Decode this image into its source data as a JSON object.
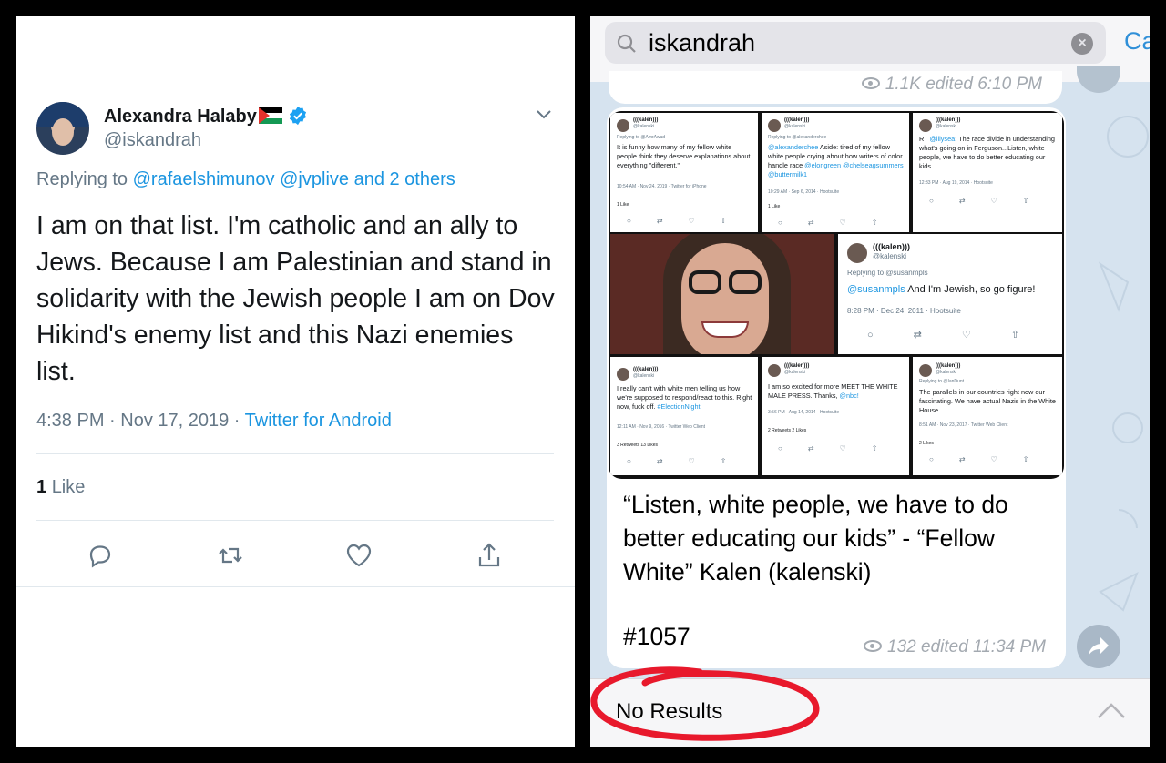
{
  "tweet": {
    "author_name": "Alexandra Halaby",
    "handle": "@iskandrah",
    "replying_prefix": "Replying to",
    "replying_user1": "@rafaelshimunov",
    "replying_user2": "@jvplive",
    "replying_suffix": "and 2 others",
    "text": "I am on that list. I'm catholic and an ally to Jews. Because I am Palestinian and stand in solidarity with the Jewish people I am on Dov Hikind's enemy list and this Nazi enemies list.",
    "time": "4:38 PM · Nov 17, 2019 ·",
    "source": "Twitter for Android",
    "like_count": "1",
    "like_label": "Like"
  },
  "telegram": {
    "search_value": "iskandrah",
    "cancel_label": "Ca",
    "prev_message_meta": "1.1K edited 6:10 PM",
    "caption": "“Listen, white people, we have to do better educating our kids” - “Fellow White” Kalen (kalenski)",
    "hashtag": "#1057",
    "views": "132",
    "edited_time": "edited 11:34 PM",
    "no_results": "No Results",
    "colors": {
      "accent": "#2f8fd8",
      "annotation": "#e8192c"
    }
  },
  "collage": {
    "cards": [
      {
        "name": "(((kalen)))",
        "handle": "@kalenski",
        "replying": "Replying to @AmrAwad",
        "text": "It is funny how many of my fellow white people think they deserve explanations about everything \"different.\"",
        "meta": "10:54 AM · Nov 24, 2019 · Twitter for iPhone",
        "stats": "1 Like"
      },
      {
        "name": "(((kalen)))",
        "handle": "@kalenski",
        "replying": "Replying to @alexanderchee",
        "text_link": "@alexanderchee",
        "text": "Aside: tired of my fellow white people crying about how writers of color handle race",
        "text_link2": "@elongreen @chelseagsummers @buttermilk1",
        "meta": "10:29 AM · Sep 6, 2014 · Hootsuite",
        "stats": "1 Like"
      },
      {
        "name": "(((kalen)))",
        "handle": "@kalenski",
        "replying": "",
        "text_pre": "RT",
        "text_link": "@lilysea",
        "text": ": The race divide in understanding what's going on in Ferguson...Listen, white people, we have to do better educating our kids...",
        "meta": "12:33 PM · Aug 19, 2014 · Hootsuite",
        "stats": ""
      },
      {
        "name": "(((kalen)))",
        "handle": "@kalenski",
        "replying": "Replying to @susanmpls",
        "text_link": "@susanmpls",
        "text": "And I'm Jewish, so go figure!",
        "meta": "8:28 PM · Dec 24, 2011 · Hootsuite",
        "stats": ""
      },
      {
        "name": "(((kalen)))",
        "handle": "@kalenski",
        "replying": "",
        "text": "I really can't with white men telling us how we're supposed to respond/react to this. Right now, fuck off.",
        "text_link": "#ElectionNight",
        "meta": "12:11 AM · Nov 9, 2016 · Twitter Web Client",
        "stats": "3 Retweets   13 Likes"
      },
      {
        "name": "(((kalen)))",
        "handle": "@kalenski",
        "replying": "",
        "text": "I am so excited for more MEET THE WHITE MALE PRESS. Thanks,",
        "text_link": "@nbc!",
        "meta": "3:56 PM · Aug 14, 2014 · Hootsuite",
        "stats": "2 Retweets   2 Likes"
      },
      {
        "name": "(((kalen)))",
        "handle": "@kalenski",
        "replying": "Replying to @IanDunt",
        "text": "The parallels in our countries right now our fascinating. We have actual Nazis in the White House.",
        "meta": "8:51 AM · Nov 23, 2017 · Twitter Web Client",
        "stats": "2 Likes"
      }
    ]
  }
}
